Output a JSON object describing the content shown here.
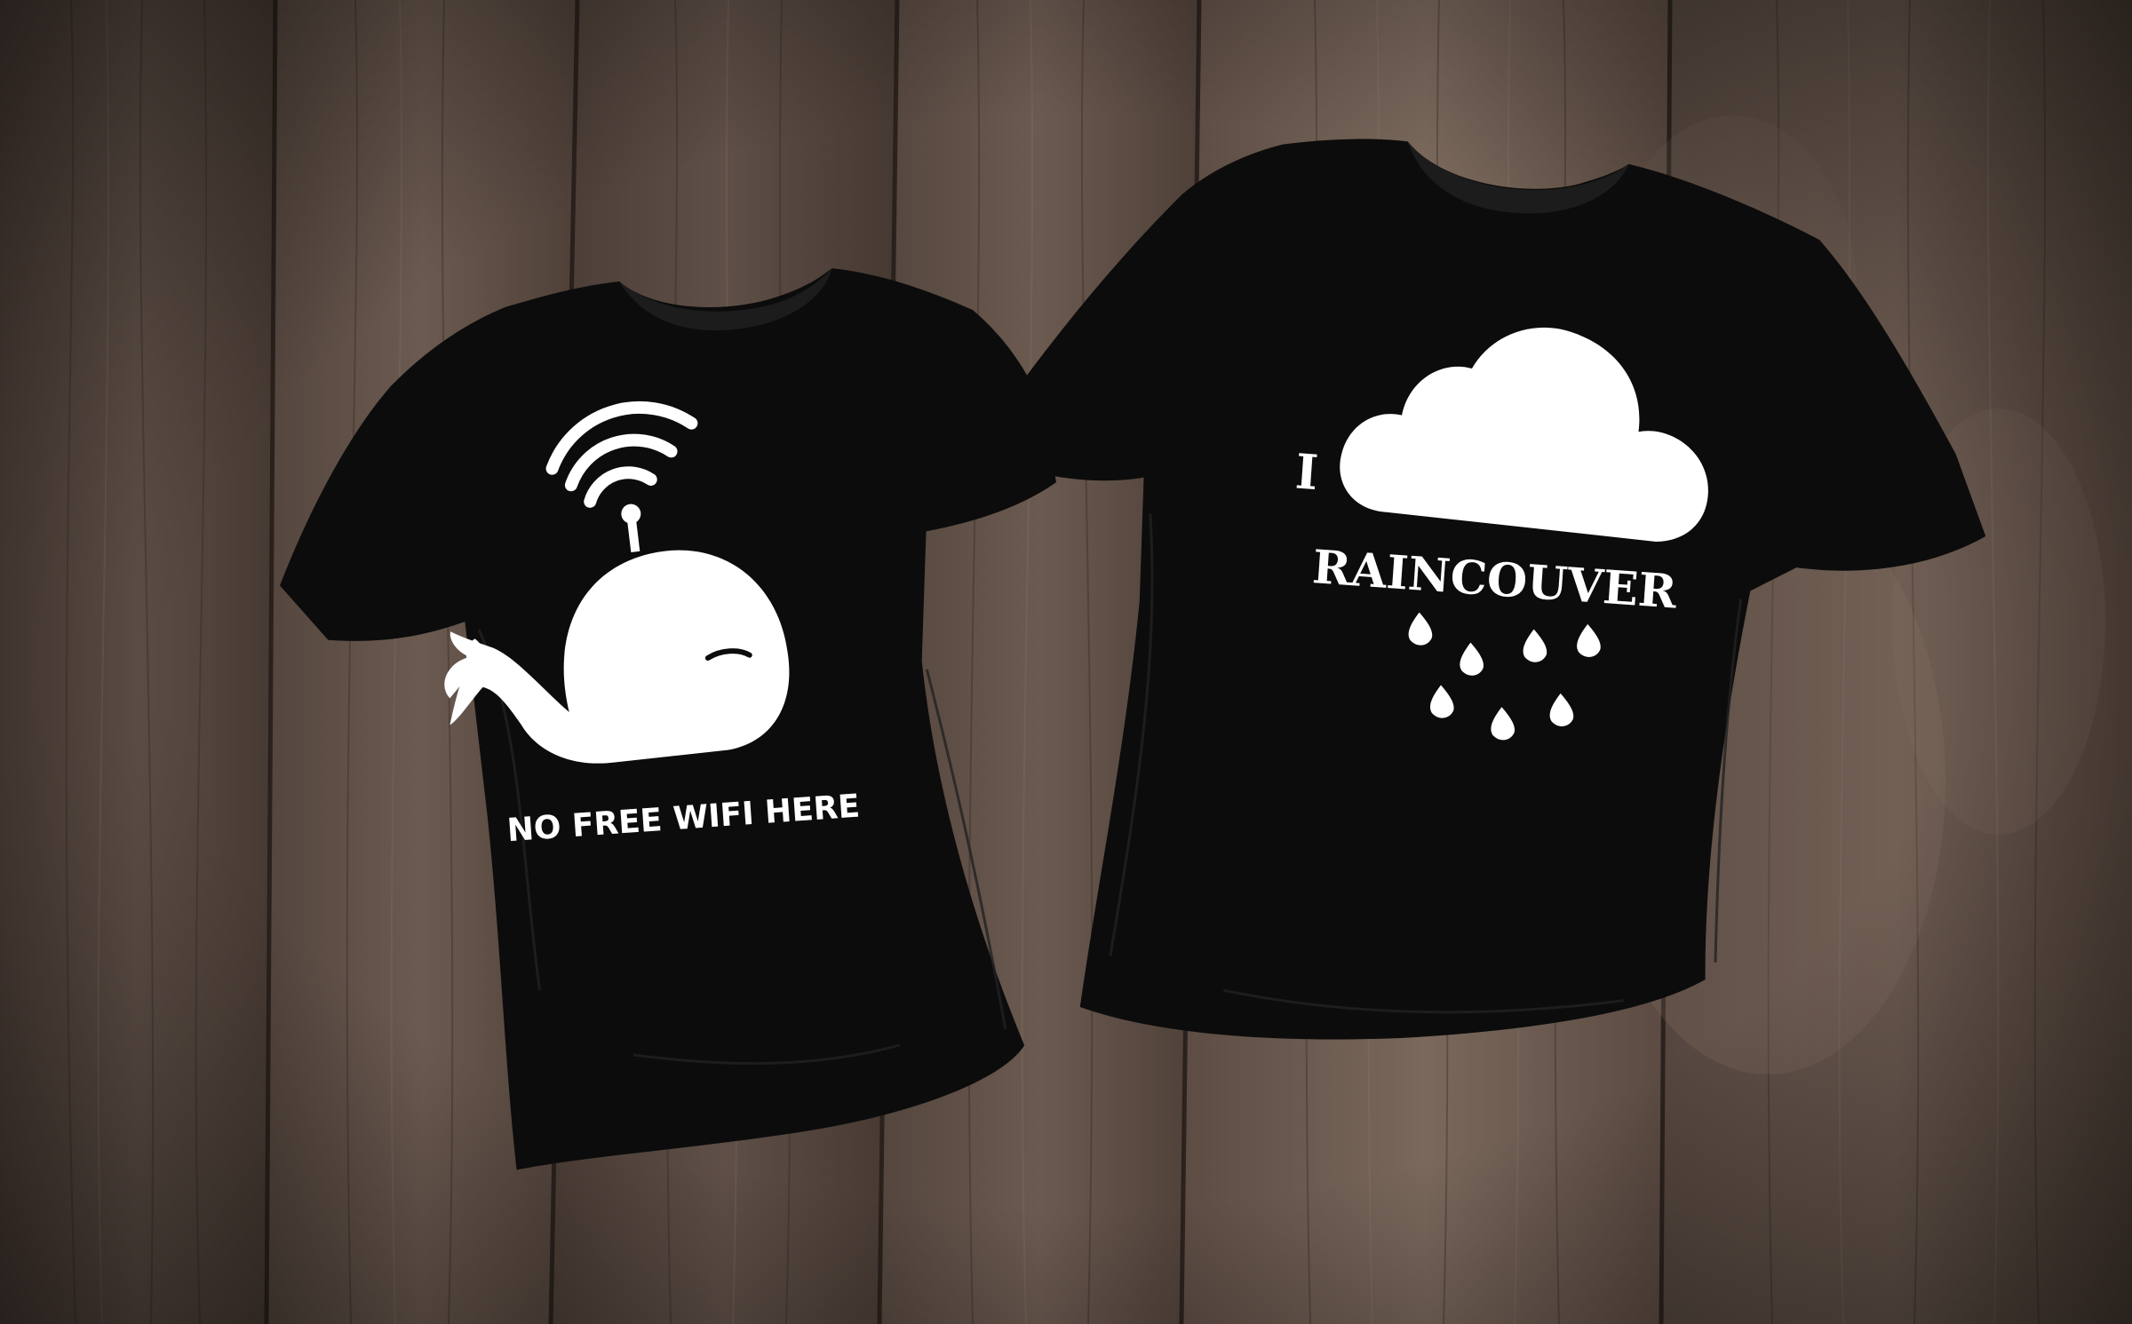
{
  "scene": {
    "background": "dark-wood-planks",
    "colors": {
      "wood_dark": "#3b2f29",
      "wood_mid": "#5a4b43",
      "wood_light": "#77665c",
      "shirt": "#0b0b0b",
      "print": "#ffffff"
    }
  },
  "shirt_left": {
    "graphic": "whale-wifi",
    "text": "NO FREE WIFI HERE"
  },
  "shirt_right": {
    "graphic": "rain-cloud",
    "line1": "I",
    "line2": "RAINCOUVER"
  }
}
